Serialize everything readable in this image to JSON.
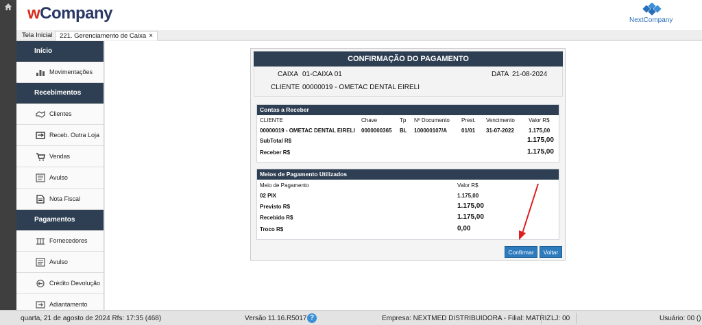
{
  "header": {
    "brand_w": "w",
    "brand_rest": "Company",
    "partner_logo_text": "NextCompany"
  },
  "tabs": [
    {
      "label": "Tela Inicial"
    },
    {
      "label": "221. Gerenciamento de Caixa",
      "close": "×"
    }
  ],
  "sidebar": {
    "sections": [
      {
        "label": "Início",
        "items": [
          {
            "label": "Movimentações",
            "icon": "chart-icon"
          }
        ]
      },
      {
        "label": "Recebimentos",
        "items": [
          {
            "label": "Clientes",
            "icon": "handshake-icon"
          },
          {
            "label": "Receb. Outra Loja",
            "icon": "transfer-icon"
          },
          {
            "label": "Vendas",
            "icon": "cart-icon"
          },
          {
            "label": "Avulso",
            "icon": "ledger-icon"
          },
          {
            "label": "Nota Fiscal",
            "icon": "document-icon"
          }
        ]
      },
      {
        "label": "Pagamentos",
        "items": [
          {
            "label": "Fornecedores",
            "icon": "supplier-icon"
          },
          {
            "label": "Avulso",
            "icon": "ledger-icon"
          },
          {
            "label": "Crédito Devolução",
            "icon": "refund-icon"
          },
          {
            "label": "Adiantamento",
            "icon": "advance-icon"
          }
        ]
      }
    ]
  },
  "dialog": {
    "title": "CONFIRMAÇÃO DO PAGAMENTO",
    "caixa_label": "CAIXA",
    "caixa_value": "01-CAIXA 01",
    "data_label": "DATA",
    "data_value": "21-08-2024",
    "cliente_label": "CLIENTE",
    "cliente_value": "00000019 - OMETAC DENTAL EIRELI",
    "contas": {
      "title": "Contas a Receber",
      "columns": [
        "CLIENTE",
        "Chave",
        "Tp",
        "Nº Documento",
        "Prest.",
        "Vencimento",
        "Valor R$"
      ],
      "rows": [
        [
          "00000019 - OMETAC DENTAL EIRELI",
          "0000000365",
          "BL",
          "100000107/A",
          "01/01",
          "31-07-2022",
          "1.175,00"
        ]
      ],
      "subtotal_label": "SubTotal R$",
      "subtotal_value": "1.175,00",
      "receber_label": "Receber R$",
      "receber_value": "1.175,00"
    },
    "meios": {
      "title": "Meios de Pagamento Utilizados",
      "col_meio": "Meio de Pagamento",
      "col_valor": "Valor R$",
      "rows": [
        {
          "meio": "02 PIX",
          "valor": "1.175,00"
        }
      ],
      "previsto_label": "Previsto R$",
      "previsto_value": "1.175,00",
      "recebido_label": "Recebido R$",
      "recebido_value": "1.175,00",
      "troco_label": "Troco R$",
      "troco_value": "0,00"
    },
    "confirm_label": "Confirmar",
    "back_label": "Voltar"
  },
  "status": {
    "datetime": "quarta, 21 de agosto de 2024  Rfs: 17:35 (468)",
    "version": "Versão 11.16.R5017",
    "help": "?",
    "empresa": "Empresa: NEXTMED DISTRIBUIDORA - Filial: MATRIZ",
    "loja": "LJ: 00",
    "usuario": "Usuário: 00 ()"
  },
  "colors": {
    "navy": "#2f3f53",
    "button_blue": "#2d7bbd",
    "annotation_arrow": "#e01c1c",
    "brand_red": "#d92c1c",
    "brand_navy": "#2a3866"
  }
}
